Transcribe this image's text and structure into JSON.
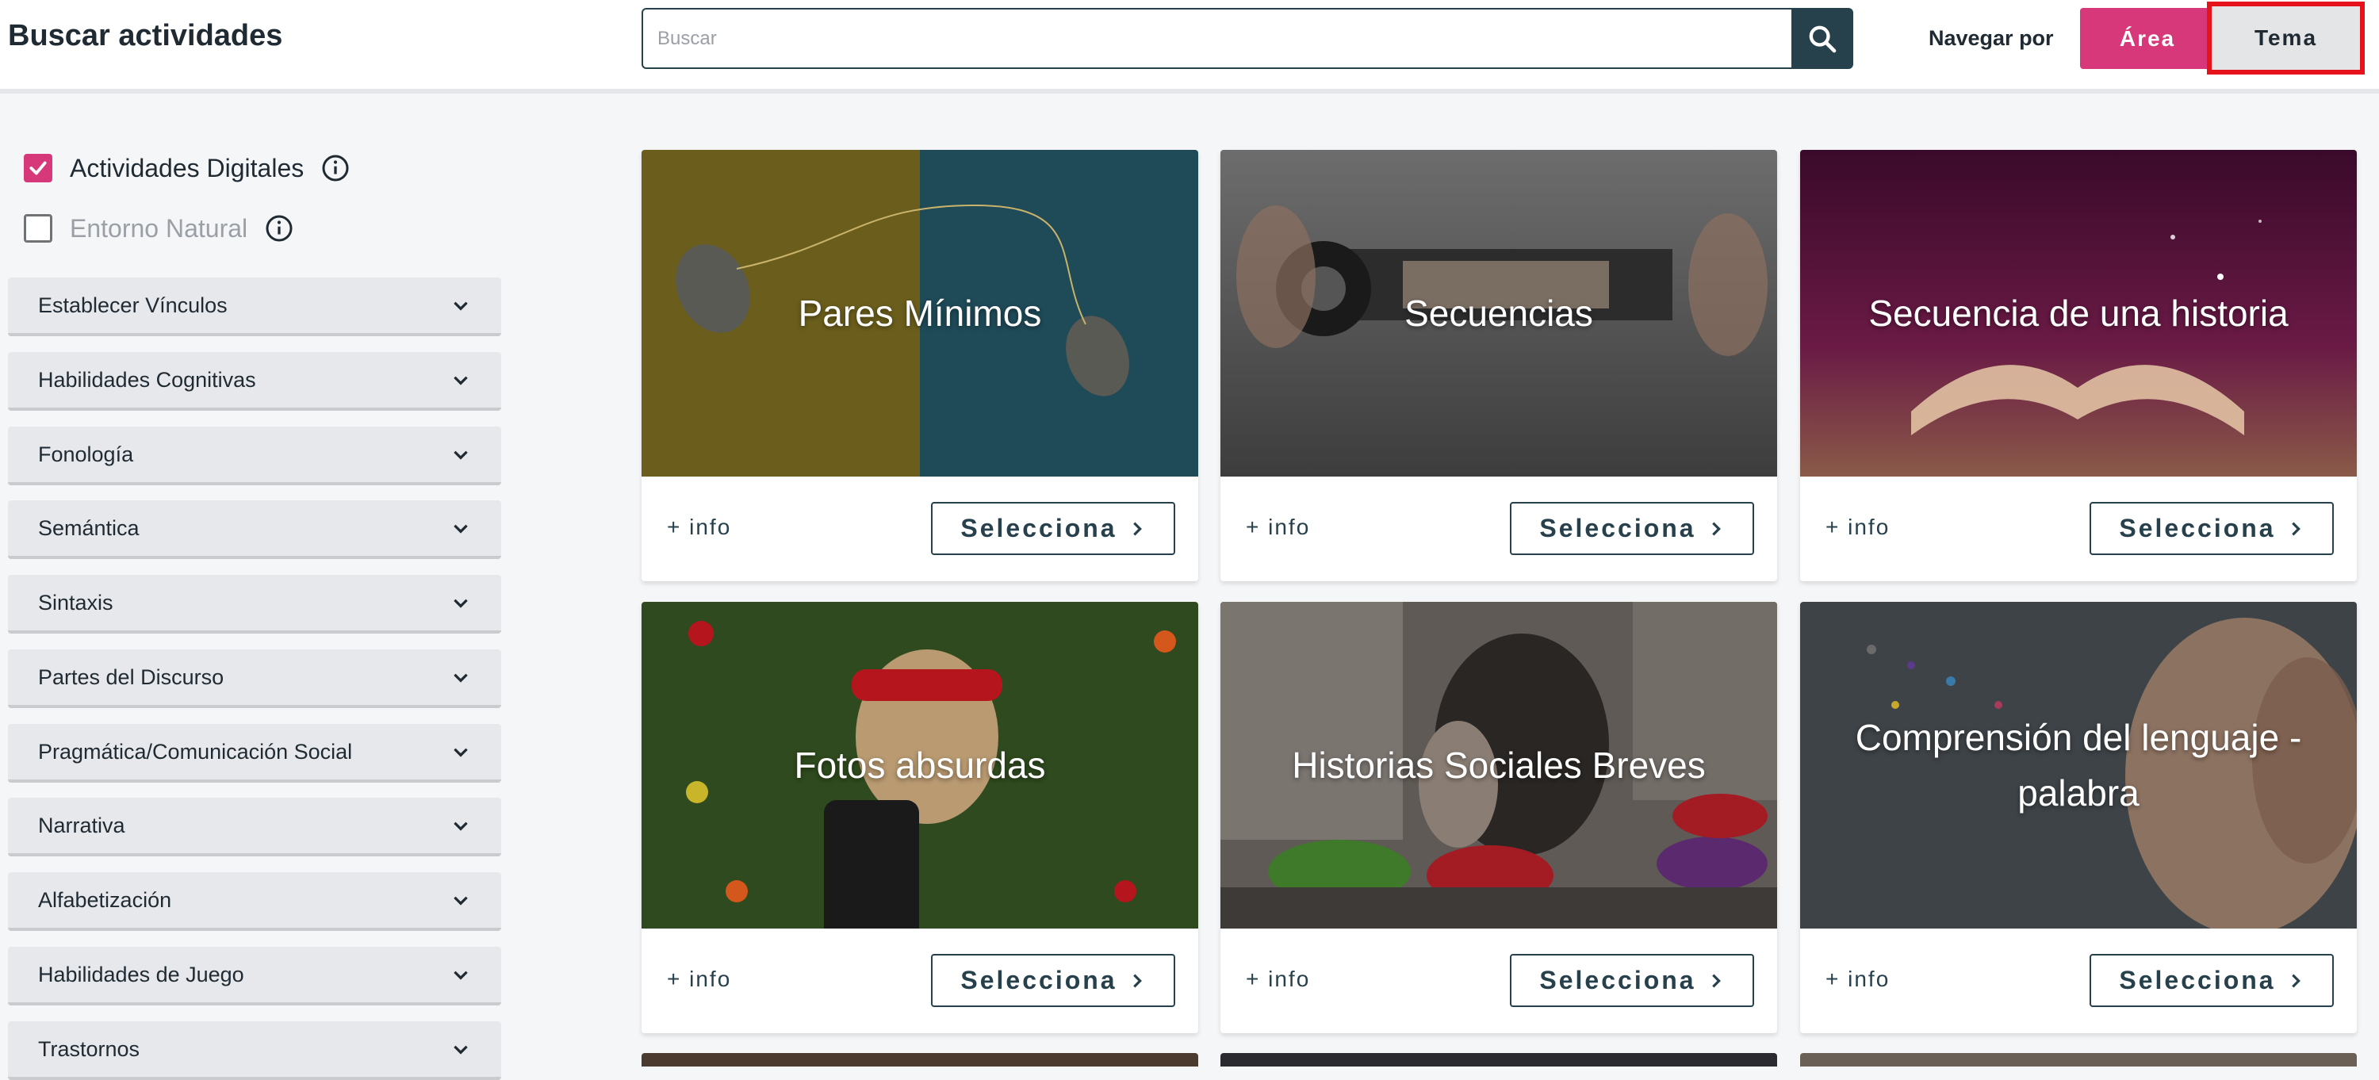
{
  "header": {
    "title": "Buscar actividades",
    "search_placeholder": "Buscar",
    "nav_label": "Navegar por",
    "btn_area": "Área",
    "btn_tema": "Tema"
  },
  "filters": [
    {
      "label": "Actividades Digitales",
      "checked": true
    },
    {
      "label": "Entorno Natural",
      "checked": false
    }
  ],
  "categories": [
    "Establecer Vínculos",
    "Habilidades Cognitivas",
    "Fonología",
    "Semántica",
    "Sintaxis",
    "Partes del Discurso",
    "Pragmática/Comunicación Social",
    "Narrativa",
    "Alfabetización",
    "Habilidades de Juego",
    "Trastornos"
  ],
  "cards": [
    {
      "title": "Pares Mínimos",
      "info": "+ info",
      "button": "Selecciona"
    },
    {
      "title": "Secuencias",
      "info": "+ info",
      "button": "Selecciona"
    },
    {
      "title": "Secuencia de una historia",
      "info": "+ info",
      "button": "Selecciona"
    },
    {
      "title": "Fotos absurdas",
      "info": "+ info",
      "button": "Selecciona"
    },
    {
      "title": "Historias Sociales Breves",
      "info": "+ info",
      "button": "Selecciona"
    },
    {
      "title": "Comprensión del lenguaje - palabra",
      "info": "+ info",
      "button": "Selecciona"
    }
  ],
  "colors": {
    "accent": "#d6387a",
    "dark": "#27414c",
    "highlight": "#e6121c"
  }
}
